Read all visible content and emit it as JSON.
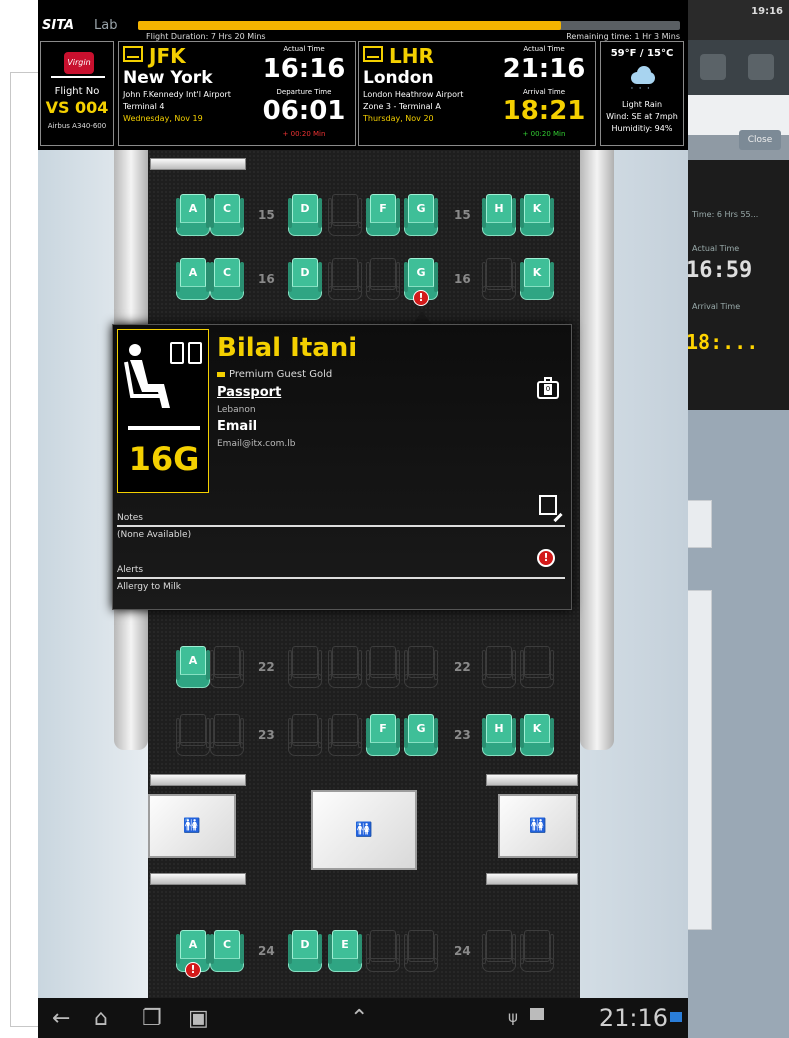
{
  "header": {
    "brand": "SITA",
    "lab": "Lab",
    "flight_duration": "Flight Duration: 7 Hrs 20 Mins",
    "remaining": "Remaining time: 1 Hr 3 Mins",
    "progress_fraction": 0.78
  },
  "flight": {
    "label": "Flight No",
    "number": "VS 004",
    "aircraft": "Airbus A340-600"
  },
  "departure": {
    "code": "JFK",
    "city": "New York",
    "airport": "John F.Kennedy Int'l Airport",
    "terminal": "Terminal 4",
    "date": "Wednesday, Nov 19",
    "time_label_1": "Actual Time",
    "time_1": "16:16",
    "time_label_2": "Departure Time",
    "time_2": "06:01",
    "delay": "+ 00:20 Min"
  },
  "arrival": {
    "code": "LHR",
    "city": "London",
    "airport": "London Heathrow Airport",
    "terminal": "Zone 3 - Terminal A",
    "date": "Thursday, Nov 20",
    "time_label_1": "Actual Time",
    "time_1": "21:16",
    "time_label_2": "Arrival Time",
    "time_2": "18:21",
    "delay": "+ 00:20 Min"
  },
  "weather": {
    "temp": "59°F / 15°C",
    "description": "Light Rain",
    "wind": "Wind: SE at 7mph",
    "humidity": "Humiditiy: 94%",
    "icon": "rain-cloud-icon"
  },
  "seatmap": {
    "rows": [
      {
        "row": "15",
        "seats": [
          {
            "letter": "A",
            "occupied": true
          },
          {
            "letter": "C",
            "occupied": true
          },
          {
            "letter": "D",
            "occupied": true
          },
          {
            "letter": "",
            "occupied": false
          },
          {
            "letter": "F",
            "occupied": true
          },
          {
            "letter": "G",
            "occupied": true
          },
          {
            "letter": "H",
            "occupied": true
          },
          {
            "letter": "K",
            "occupied": true
          }
        ]
      },
      {
        "row": "16",
        "seats": [
          {
            "letter": "A",
            "occupied": true
          },
          {
            "letter": "C",
            "occupied": true
          },
          {
            "letter": "D",
            "occupied": true
          },
          {
            "letter": "",
            "occupied": false
          },
          {
            "letter": "",
            "occupied": false
          },
          {
            "letter": "G",
            "occupied": true,
            "alert": true
          },
          {
            "letter": "",
            "occupied": false
          },
          {
            "letter": "K",
            "occupied": true
          }
        ]
      },
      {
        "row": "22",
        "seats": [
          {
            "letter": "A",
            "occupied": true
          },
          {
            "letter": "",
            "occupied": false
          },
          {
            "letter": "",
            "occupied": false
          },
          {
            "letter": "",
            "occupied": false
          },
          {
            "letter": "",
            "occupied": false
          },
          {
            "letter": "",
            "occupied": false
          },
          {
            "letter": "",
            "occupied": false
          },
          {
            "letter": "",
            "occupied": false
          }
        ]
      },
      {
        "row": "23",
        "seats": [
          {
            "letter": "",
            "occupied": false
          },
          {
            "letter": "",
            "occupied": false
          },
          {
            "letter": "",
            "occupied": false
          },
          {
            "letter": "",
            "occupied": false
          },
          {
            "letter": "F",
            "occupied": true
          },
          {
            "letter": "G",
            "occupied": true
          },
          {
            "letter": "H",
            "occupied": true
          },
          {
            "letter": "K",
            "occupied": true
          }
        ]
      },
      {
        "row": "24",
        "seats": [
          {
            "letter": "A",
            "occupied": true,
            "alert": true
          },
          {
            "letter": "C",
            "occupied": true
          },
          {
            "letter": "D",
            "occupied": true
          },
          {
            "letter": "E",
            "occupied": true
          },
          {
            "letter": "",
            "occupied": false
          },
          {
            "letter": "",
            "occupied": false
          },
          {
            "letter": "",
            "occupied": false
          },
          {
            "letter": "",
            "occupied": false
          }
        ]
      }
    ]
  },
  "passenger": {
    "seat": "16G",
    "name": "Bilal Itani",
    "tier": "Premium Guest Gold",
    "passport_label": "Passport",
    "passport_value": "Lebanon",
    "email_label": "Email",
    "email_value": "Email@itx.com.lb",
    "bag_count": "0",
    "notes_label": "Notes",
    "notes_value": "(None Available)",
    "alerts_label": "Alerts",
    "alerts_value": "Allergy to Milk"
  },
  "statusbar": {
    "clock": "21:16"
  },
  "background_app": {
    "clock": "19:16",
    "close_label": "Close",
    "time_text": "Time: 6 Hrs 55...",
    "label_actual": "Actual Time",
    "big_time": "16:59",
    "label_arrival": "Arrival Time",
    "yellow_time": "18:..."
  },
  "colors": {
    "accent_yellow": "#f4d000",
    "seat_green": "#3fbf98",
    "alert_red": "#d21a1a",
    "progress": "#f4b400"
  }
}
